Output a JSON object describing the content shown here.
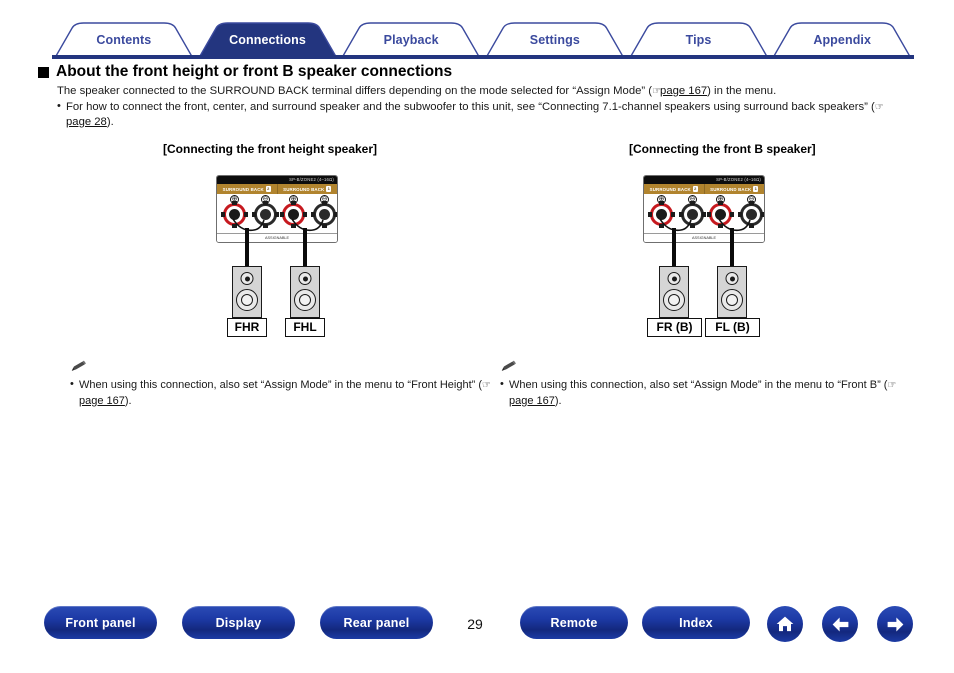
{
  "tabs": [
    {
      "label": "Contents",
      "active": false
    },
    {
      "label": "Connections",
      "active": true
    },
    {
      "label": "Playback",
      "active": false
    },
    {
      "label": "Settings",
      "active": false
    },
    {
      "label": "Tips",
      "active": false
    },
    {
      "label": "Appendix",
      "active": false
    }
  ],
  "heading": "About the front height or front B speaker connections",
  "intro": {
    "line1_a": "The speaker connected to the SURROUND BACK terminal differs depending on the mode selected for “Assign Mode” (",
    "line1_link": "page 167",
    "line1_b": ") in the menu.",
    "bullet_a": "For how to connect the front, center, and surround speaker and the subwoofer to this unit, see “Connecting 7.1-channel speakers using surround back speakers” (",
    "bullet_link": "page 28",
    "bullet_b": ")."
  },
  "diagrams": {
    "left": {
      "caption": "[Connecting the front height speaker]",
      "panel": {
        "top_text": "SP-B/ZONE2  (4–16Ω)",
        "terminal_left": "SURROUND BACK",
        "terminal_left_badge": "2",
        "terminal_right": "SURROUND BACK",
        "terminal_right_badge": "1",
        "bottom_text": "ASSIGNABLE",
        "sign_plus": "⊕",
        "sign_minus": "⊖"
      },
      "speakers": [
        {
          "label": "FHR"
        },
        {
          "label": "FHL"
        }
      ]
    },
    "right": {
      "caption": "[Connecting the front B speaker]",
      "panel": {
        "top_text": "SP-B/ZONE2  (4–16Ω)",
        "terminal_left": "SURROUND BACK",
        "terminal_left_badge": "2",
        "terminal_right": "SURROUND BACK",
        "terminal_right_badge": "1",
        "bottom_text": "ASSIGNABLE",
        "sign_plus": "⊕",
        "sign_minus": "⊖"
      },
      "speakers": [
        {
          "label": "FR (B)"
        },
        {
          "label": "FL (B)"
        }
      ]
    }
  },
  "notes": {
    "left": {
      "icon": "pencil-icon",
      "text_a": "When using this connection, also set “Assign Mode” in the menu to “Front Height” (",
      "link": "page 167",
      "text_b": ")."
    },
    "right": {
      "icon": "pencil-icon",
      "text_a": "When using this connection, also set “Assign Mode” in the menu to “Front B” (",
      "link": "page 167",
      "text_b": ")."
    }
  },
  "bottom": {
    "buttons": [
      {
        "label": "Front panel"
      },
      {
        "label": "Display"
      },
      {
        "label": "Rear panel"
      },
      {
        "label": "Remote"
      },
      {
        "label": "Index"
      }
    ],
    "page_number": "29",
    "icons": [
      {
        "name": "home-icon"
      },
      {
        "name": "arrow-left-icon"
      },
      {
        "name": "arrow-right-icon"
      }
    ]
  },
  "colors": {
    "accent_navy": "#23357f",
    "tab_text": "#3b4a9e",
    "terminal_gold": "#b1842e",
    "post_red": "#c6191f"
  }
}
